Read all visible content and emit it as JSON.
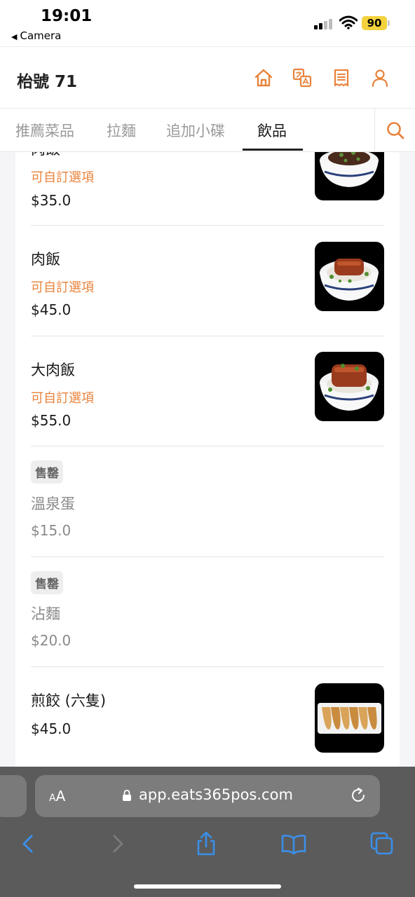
{
  "status_bar": {
    "time": "19:01",
    "back_label": "Camera",
    "battery": "90"
  },
  "header": {
    "title": "枱號 71",
    "icons": [
      "home-icon",
      "translate-icon",
      "receipt-icon",
      "user-icon"
    ]
  },
  "tabs": {
    "items": [
      {
        "label": "推薦菜品",
        "active": false
      },
      {
        "label": "拉麵",
        "active": false
      },
      {
        "label": "追加小碟",
        "active": false
      },
      {
        "label": "飲品",
        "active": true
      }
    ],
    "search_icon": "search-icon"
  },
  "menu": {
    "items": [
      {
        "name": "肉飯",
        "custom": "可自訂選項",
        "price": "$35.0",
        "sold_out": false,
        "has_image": true
      },
      {
        "name": "肉飯",
        "custom": "可自訂選項",
        "price": "$45.0",
        "sold_out": false,
        "has_image": true
      },
      {
        "name": "大肉飯",
        "custom": "可自訂選項",
        "price": "$55.0",
        "sold_out": false,
        "has_image": true
      },
      {
        "name": "溫泉蛋",
        "badge": "售罄",
        "price": "$15.0",
        "sold_out": true,
        "has_image": false
      },
      {
        "name": "沾麵",
        "badge": "售罄",
        "price": "$20.0",
        "sold_out": true,
        "has_image": false
      },
      {
        "name": "煎餃 (六隻)",
        "price": "$45.0",
        "sold_out": false,
        "has_image": true
      }
    ]
  },
  "safari": {
    "text_size_label": "AA",
    "url": "app.eats365pos.com",
    "toolbar_icons": [
      "back-icon",
      "forward-icon",
      "share-icon",
      "bookmarks-icon",
      "tabs-icon"
    ]
  },
  "colors": {
    "accent": "#e8823b",
    "safari_bar": "#5b5b5b"
  }
}
